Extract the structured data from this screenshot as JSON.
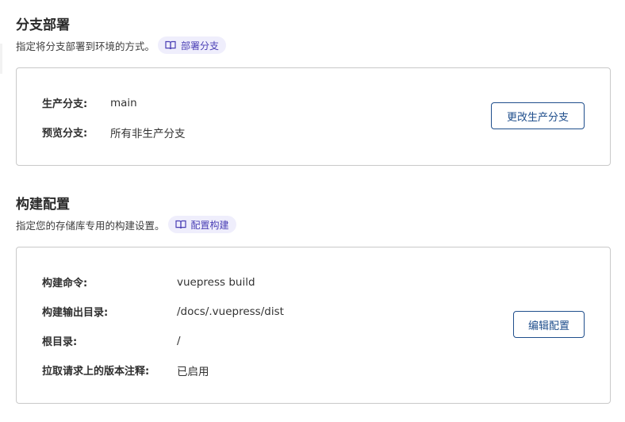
{
  "branch_section": {
    "title": "分支部署",
    "description": "指定将分支部署到环境的方式。",
    "doc_link": {
      "label": "部署分支",
      "icon": "book-icon"
    },
    "rows": [
      {
        "label": "生产分支:",
        "value": "main"
      },
      {
        "label": "预览分支:",
        "value": "所有非生产分支"
      }
    ],
    "button_label": "更改生产分支"
  },
  "build_section": {
    "title": "构建配置",
    "description": "指定您的存储库专用的构建设置。",
    "doc_link": {
      "label": "配置构建",
      "icon": "book-icon"
    },
    "rows": [
      {
        "label": "构建命令:",
        "value": "vuepress build"
      },
      {
        "label": "构建输出目录:",
        "value": "/docs/.vuepress/dist"
      },
      {
        "label": "根目录:",
        "value": "/"
      },
      {
        "label": "拉取请求上的版本注释:",
        "value": "已启用"
      }
    ],
    "button_label": "编辑配置"
  },
  "colors": {
    "accent": "#1f4e8c",
    "pill_bg": "#efeefc",
    "pill_text": "#4a3fb5",
    "border": "#c9c9c9"
  }
}
